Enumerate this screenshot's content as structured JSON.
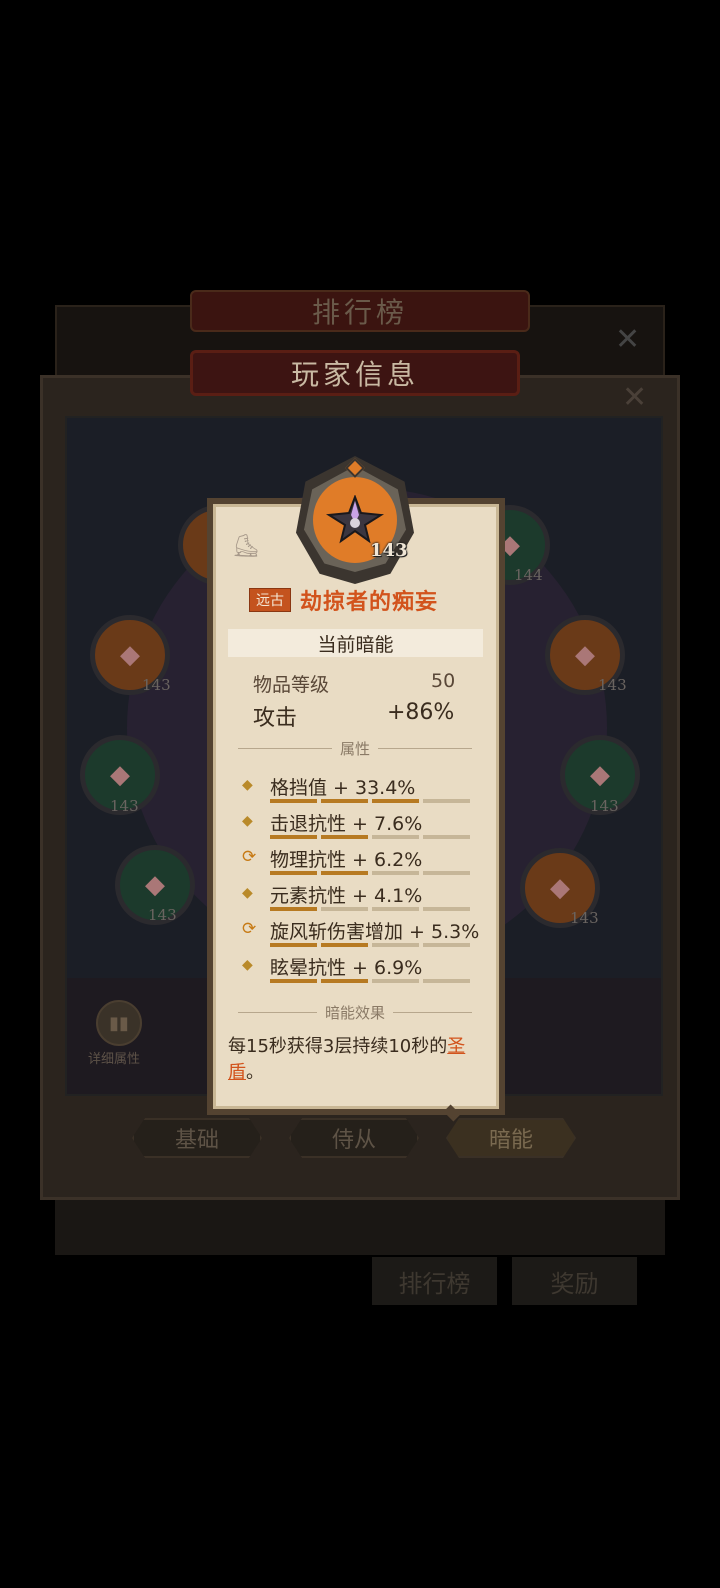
{
  "background": {
    "ranking_title": "排行榜",
    "player_title": "玩家信息",
    "details_label": "详细属性",
    "tabs": [
      "基础",
      "侍从",
      "暗能"
    ],
    "bottom_buttons": [
      "排行榜",
      "奖励"
    ],
    "slots": [
      {
        "level": "144"
      },
      {
        "level": "143"
      },
      {
        "level": "143"
      },
      {
        "level": "143"
      },
      {
        "level": "143"
      },
      {
        "level": "143"
      },
      {
        "level": "143"
      }
    ]
  },
  "tooltip": {
    "item_level_badge": "143",
    "rarity": "远古",
    "name": "劫掠者的痴妄",
    "section_current": "当前暗能",
    "item_level_label": "物品等级",
    "item_level_value": "50",
    "attack_label": "攻击",
    "attack_value": "+86%",
    "attributes_header": "属性",
    "attributes": [
      {
        "text": "格挡值 + 33.4%",
        "icon": "diamond-icon",
        "fill": 3
      },
      {
        "text": "击退抗性 + 7.6%",
        "icon": "diamond-icon",
        "fill": 2
      },
      {
        "text": "物理抗性 + 6.2%",
        "icon": "reroll-icon",
        "fill": 2
      },
      {
        "text": "元素抗性 + 4.1%",
        "icon": "diamond-icon",
        "fill": 1
      },
      {
        "text": "旋风斩伤害增加 + 5.3%",
        "icon": "reroll-icon",
        "fill": 2
      },
      {
        "text": "眩晕抗性 + 6.9%",
        "icon": "diamond-icon",
        "fill": 2
      }
    ],
    "effect_header": "暗能效果",
    "effect_text_prefix": "每15秒获得3层持续10秒的",
    "effect_highlight": "圣盾",
    "effect_suffix": "。"
  },
  "colors": {
    "rarity_orange": "#c4531e",
    "name_orange": "#d2531c",
    "card_bg": "#e9dcc4",
    "badge_orange": "#e07c28"
  }
}
